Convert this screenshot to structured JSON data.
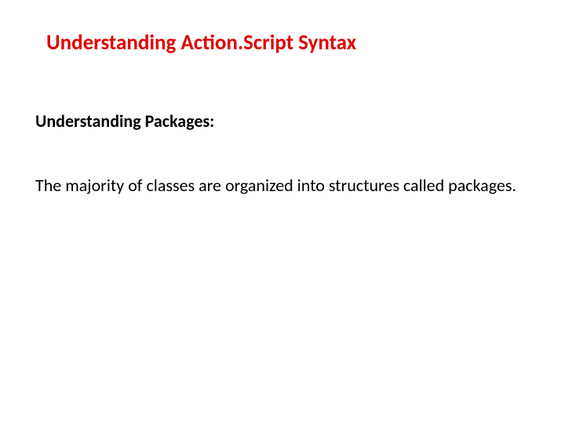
{
  "title": "Understanding Action.Script Syntax",
  "subtitle": "Understanding Packages:",
  "body": "The majority of classes are organized into structures called packages."
}
